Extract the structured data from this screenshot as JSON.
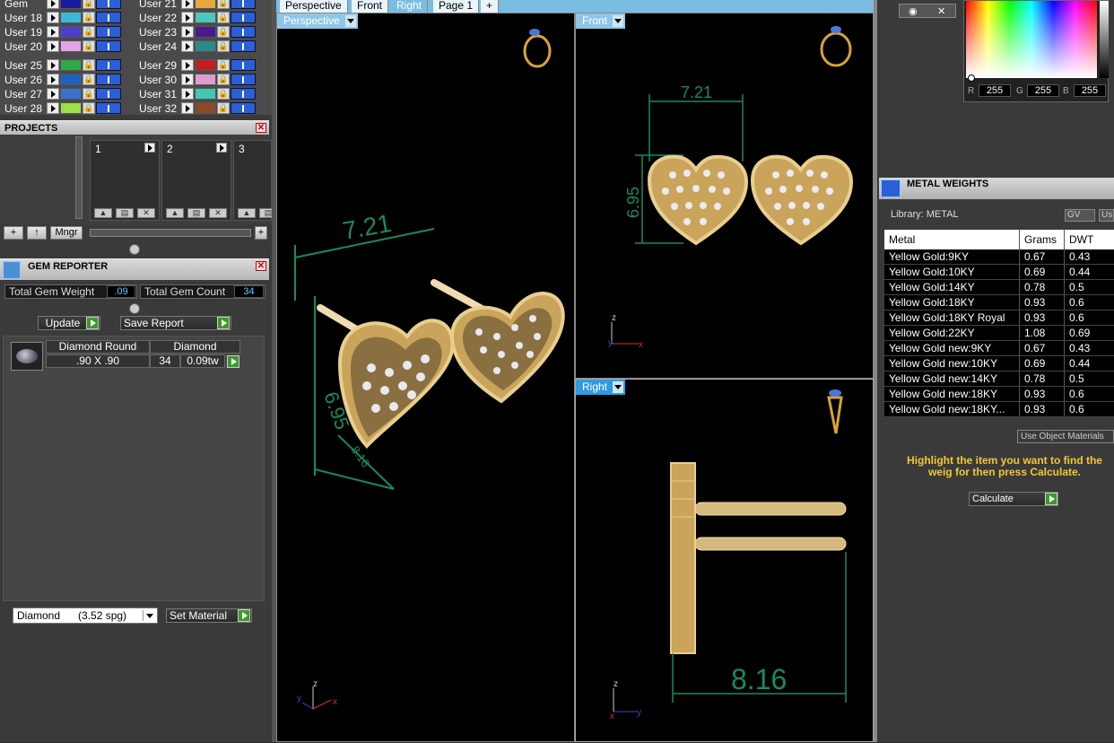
{
  "layers": {
    "left_col": [
      {
        "name": "Gem",
        "color": "#1a1aa0"
      },
      {
        "name": "User 18",
        "color": "#3fb7d9"
      },
      {
        "name": "User 19",
        "color": "#4a3fd0"
      },
      {
        "name": "User 20",
        "color": "#e2a5e4"
      },
      {
        "name": "User 25",
        "color": "#2ea84a"
      },
      {
        "name": "User 26",
        "color": "#2060c0"
      },
      {
        "name": "User 27",
        "color": "#3a70d0"
      },
      {
        "name": "User 28",
        "color": "#9be046"
      }
    ],
    "right_col": [
      {
        "name": "User 21",
        "color": "#e8a83a"
      },
      {
        "name": "User 22",
        "color": "#4dc7b8"
      },
      {
        "name": "User 23",
        "color": "#4a1a8a"
      },
      {
        "name": "User 24",
        "color": "#2a8a8a"
      },
      {
        "name": "User 29",
        "color": "#c02020"
      },
      {
        "name": "User 30",
        "color": "#e29ad0"
      },
      {
        "name": "User 31",
        "color": "#40c8b0"
      },
      {
        "name": "User 32",
        "color": "#8a4a2a"
      }
    ]
  },
  "projects": {
    "title": "PROJECTS",
    "cards": [
      "1",
      "2",
      "3"
    ],
    "mngr_label": "Mngr"
  },
  "gem_reporter": {
    "title": "GEM REPORTER",
    "total_weight_label": "Total Gem Weight",
    "total_weight_value": ".09",
    "total_count_label": "Total Gem Count",
    "total_count_value": "34",
    "update_label": "Update",
    "save_report_label": "Save Report",
    "row": {
      "shape": "Diamond Round",
      "size": ".90 X .90",
      "material": "Diamond",
      "count": "34",
      "weight": "0.09tw"
    },
    "material_select": "Diamond      (3.52 spg)",
    "set_material_label": "Set Material"
  },
  "tabs": [
    "Perspective",
    "Front",
    "Right",
    "Page 1",
    "+"
  ],
  "viewports": {
    "perspective": {
      "label": "Perspective",
      "dim_width": "7.21",
      "dim_height": "6.95",
      "dim_depth": "8.16"
    },
    "front": {
      "label": "Front",
      "dim_width": "7.21",
      "dim_height": "6.95"
    },
    "right": {
      "label": "Right",
      "dim_depth": "8.16"
    }
  },
  "color_picker": {
    "r": "255",
    "g": "255",
    "b": "255",
    "r_label": "R",
    "g_label": "G",
    "b_label": "B"
  },
  "metal_weights": {
    "title": "METAL WEIGHTS",
    "library": "Library: METAL",
    "gv_label": "GV",
    "us_label": "Us",
    "columns": [
      "Metal",
      "Grams",
      "DWT"
    ],
    "rows": [
      [
        "Yellow Gold:9KY",
        "0.67",
        "0.43"
      ],
      [
        "Yellow Gold:10KY",
        "0.69",
        "0.44"
      ],
      [
        "Yellow Gold:14KY",
        "0.78",
        "0.5"
      ],
      [
        "Yellow Gold:18KY",
        "0.93",
        "0.6"
      ],
      [
        "Yellow Gold:18KY Royal",
        "0.93",
        "0.6"
      ],
      [
        "Yellow Gold:22KY",
        "1.08",
        "0.69"
      ],
      [
        "Yellow Gold new:9KY",
        "0.67",
        "0.43"
      ],
      [
        "Yellow Gold new:10KY",
        "0.69",
        "0.44"
      ],
      [
        "Yellow Gold new:14KY",
        "0.78",
        "0.5"
      ],
      [
        "Yellow Gold new:18KY",
        "0.93",
        "0.6"
      ],
      [
        "Yellow Gold new:18KY...",
        "0.93",
        "0.6"
      ]
    ],
    "use_object_label": "Use Object Materials",
    "hint": "Highlight the item you want to find the weig for then press Calculate.",
    "calculate_label": "Calculate"
  }
}
